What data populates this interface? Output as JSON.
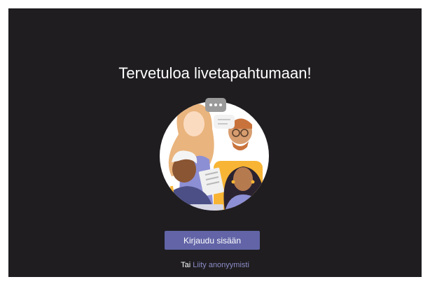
{
  "welcome": {
    "title": "Tervetuloa livetapahtumaan!"
  },
  "illustration": {
    "icon": "people-group-illustration",
    "colors": {
      "circle": "#ffffff",
      "accent": "#f8b434",
      "purple": "#6264a7"
    }
  },
  "actions": {
    "sign_in_label": "Kirjaudu sisään",
    "or_prefix": "Tai",
    "anonymous_link_label": "Liity anonyymisti"
  },
  "theme": {
    "background": "#1f1d20",
    "button": "#6264a7",
    "link": "#8b8cc7"
  }
}
